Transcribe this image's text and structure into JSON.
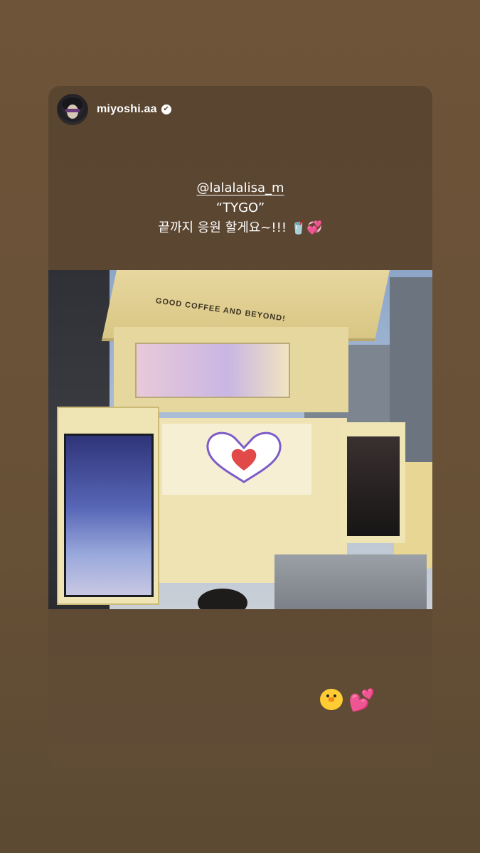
{
  "story": {
    "user": {
      "username": "miyoshi.aa",
      "verified": true,
      "verified_icon": "✔"
    },
    "caption": {
      "mention": "@lalalalisa_m",
      "line2": "“TYGO”",
      "line3": "끝까지 응원 할게요~!!! 🥤💞"
    },
    "photo": {
      "awning_text": "GOOD COFFEE AND BEYOND!"
    },
    "stickers": {
      "heart_hands": "heart-hands",
      "emoji_chick": "🐥",
      "emoji_hearts": "💕"
    }
  }
}
